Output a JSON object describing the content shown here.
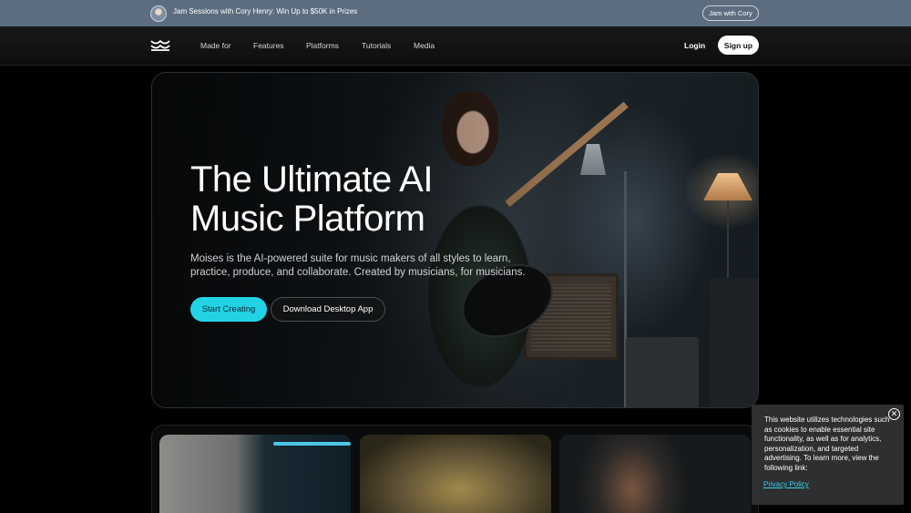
{
  "announcement": {
    "text": "Jam Sessions with Cory Henry: Win Up to $50K in Prizes",
    "button_label": "Jam with Cory"
  },
  "nav": {
    "items": [
      "Made for",
      "Features",
      "Platforms",
      "Tutorials",
      "Media"
    ],
    "login_label": "Login",
    "signup_label": "Sign up"
  },
  "hero": {
    "title_line1": "The Ultimate AI",
    "title_line2": "Music Platform",
    "description": "Moises is the AI-powered suite for music makers of all styles to learn, practice, produce, and collaborate. Created by musicians, for musicians.",
    "primary_label": "Start Creating",
    "secondary_label": "Download Desktop App"
  },
  "cookie": {
    "text": "This website utilizes technologies such as cookies to enable essential site functionality, as well as for analytics, personalization, and targeted advertising. To learn more, view the following link:",
    "link_label": "Privacy Policy",
    "close_glyph": "✕"
  },
  "colors": {
    "accent": "#22d3e6",
    "announce_bg": "#5d6d80",
    "cookie_bg": "#2d2f30",
    "link": "#36d0f0"
  },
  "icons": {
    "logo": "moises-wave-logo",
    "close": "close-icon"
  }
}
